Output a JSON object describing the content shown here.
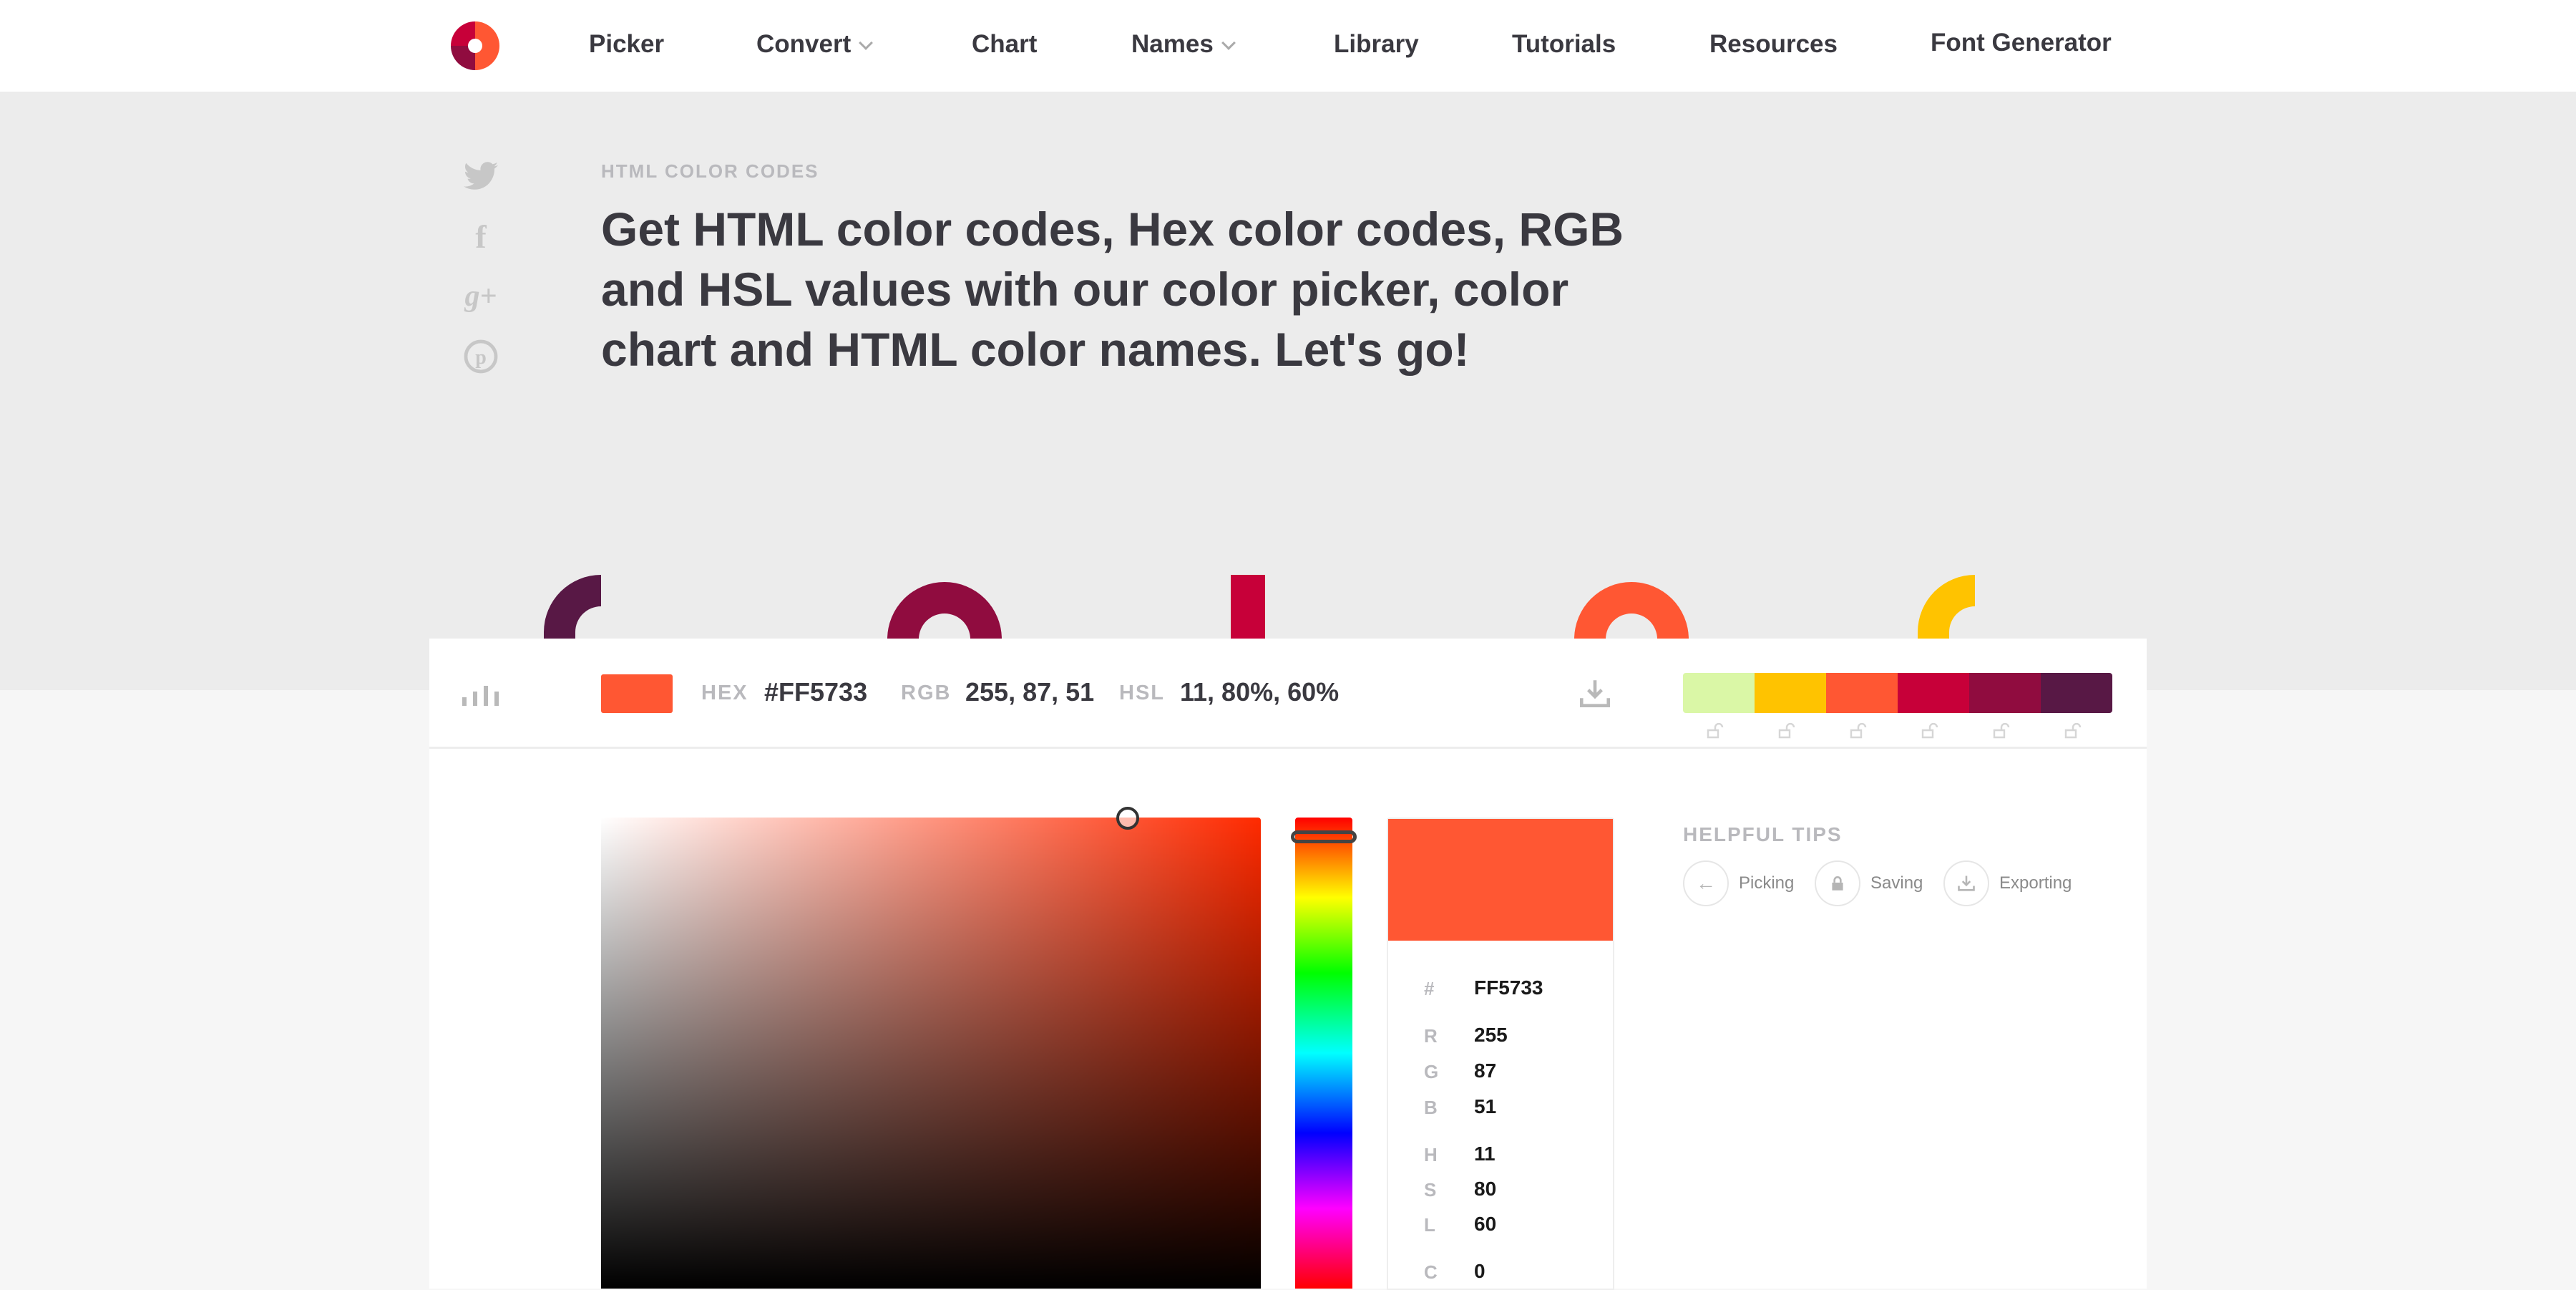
{
  "nav": {
    "items": [
      "Picker",
      "Convert",
      "Chart",
      "Names",
      "Library",
      "Tutorials",
      "Resources",
      "Font Generator"
    ]
  },
  "hero": {
    "eyebrow": "HTML COLOR CODES",
    "headline": "Get HTML color codes, Hex color codes, RGB and HSL values with our color picker, color chart and HTML color names. Let's go!",
    "social": [
      "twitter-icon",
      "facebook-icon",
      "google-plus-icon",
      "pinterest-icon"
    ]
  },
  "toolbar": {
    "hex_label": "HEX",
    "hex_value": "#FF5733",
    "rgb_label": "RGB",
    "rgb_value": "255, 87, 51",
    "hsl_label": "HSL",
    "hsl_value": "11, 80%, 60%",
    "palette": [
      "#daf7a6",
      "#ffc300",
      "#ff5733",
      "#c70039",
      "#900c3f",
      "#581845"
    ]
  },
  "picker": {
    "selected_color": "#FF5733",
    "values": [
      {
        "key": "#",
        "value": "FF5733"
      },
      {
        "key": "R",
        "value": "255"
      },
      {
        "key": "G",
        "value": "87"
      },
      {
        "key": "B",
        "value": "51"
      },
      {
        "key": "H",
        "value": "11"
      },
      {
        "key": "S",
        "value": "80"
      },
      {
        "key": "L",
        "value": "60"
      },
      {
        "key": "C",
        "value": "0"
      }
    ]
  },
  "tips": {
    "title": "HELPFUL TIPS",
    "items": [
      "Picking",
      "Saving",
      "Exporting"
    ]
  }
}
